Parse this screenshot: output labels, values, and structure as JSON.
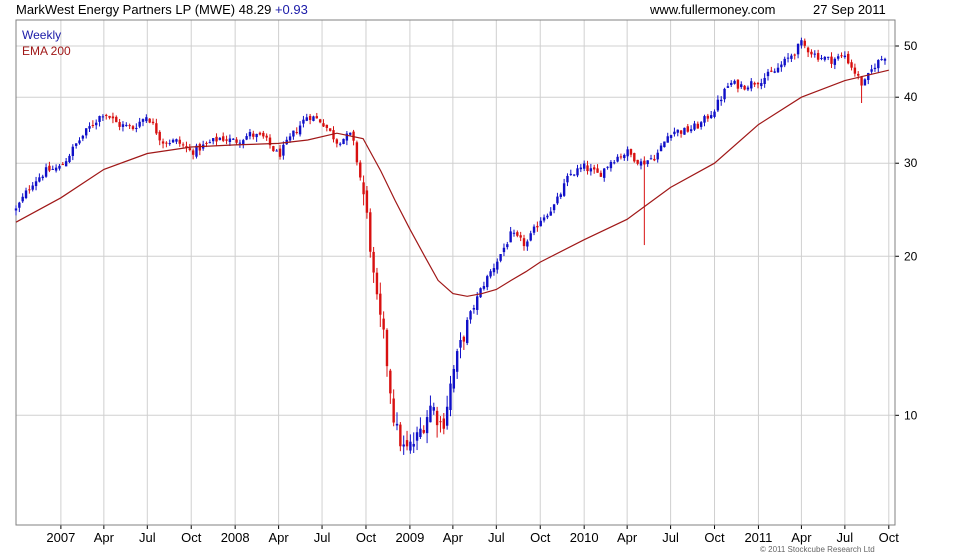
{
  "header": {
    "title": "MarkWest Energy Partners LP (MWE)",
    "price": "48.29",
    "change": "+0.93",
    "site": "www.fullermoney.com",
    "date": "27 Sep 2011"
  },
  "legend": {
    "frequency": "Weekly",
    "indicator": "EMA 200"
  },
  "credit": "© 2011 Stockcube Research Ltd",
  "colors": {
    "up": "#1010c8",
    "down": "#d81010",
    "ema": "#a01818",
    "grid": "#d0d0d0",
    "frame": "#808080"
  },
  "chart_data": {
    "type": "candlestick",
    "title": "MarkWest Energy Partners LP (MWE) 48.29 +0.93",
    "frequency": "Weekly",
    "y_scale": "log",
    "ylim": [
      6.2,
      56
    ],
    "y_ticks": [
      10,
      20,
      30,
      40,
      50
    ],
    "x_labels": [
      "2007",
      "Apr",
      "Jul",
      "Oct",
      "2008",
      "Apr",
      "Jul",
      "Oct",
      "2009",
      "Apr",
      "Jul",
      "Oct",
      "2010",
      "Apr",
      "Jul",
      "Oct",
      "2011",
      "Apr",
      "Jul",
      "Oct"
    ],
    "x_start": "2006-09-29",
    "x_end": "2011-10-14",
    "grid": true,
    "close_path": [
      [
        "2006-09-29",
        24.5
      ],
      [
        "2006-11-01",
        27.5
      ],
      [
        "2006-12-01",
        29.0
      ],
      [
        "2007-01-01",
        29.5
      ],
      [
        "2007-02-01",
        32.5
      ],
      [
        "2007-03-01",
        35.0
      ],
      [
        "2007-04-01",
        37.5
      ],
      [
        "2007-05-01",
        35.5
      ],
      [
        "2007-06-01",
        35.0
      ],
      [
        "2007-07-01",
        37.0
      ],
      [
        "2007-08-01",
        33.0
      ],
      [
        "2007-09-01",
        33.0
      ],
      [
        "2007-10-01",
        31.5
      ],
      [
        "2007-11-01",
        32.5
      ],
      [
        "2007-12-01",
        33.5
      ],
      [
        "2008-01-01",
        33.0
      ],
      [
        "2008-02-01",
        34.0
      ],
      [
        "2008-03-01",
        33.5
      ],
      [
        "2008-04-01",
        31.0
      ],
      [
        "2008-05-01",
        34.0
      ],
      [
        "2008-06-01",
        37.0
      ],
      [
        "2008-07-01",
        36.0
      ],
      [
        "2008-08-01",
        33.0
      ],
      [
        "2008-09-01",
        34.0
      ],
      [
        "2008-09-25",
        26.5
      ],
      [
        "2008-10-08",
        22.0
      ],
      [
        "2008-10-20",
        17.0
      ],
      [
        "2008-11-10",
        13.5
      ],
      [
        "2008-12-01",
        9.5
      ],
      [
        "2008-12-22",
        8.5
      ],
      [
        "2009-01-15",
        9.0
      ],
      [
        "2009-02-15",
        10.5
      ],
      [
        "2009-03-10",
        9.5
      ],
      [
        "2009-04-01",
        12.0
      ],
      [
        "2009-05-01",
        15.0
      ],
      [
        "2009-06-01",
        17.5
      ],
      [
        "2009-07-01",
        19.5
      ],
      [
        "2009-08-01",
        22.0
      ],
      [
        "2009-09-01",
        21.0
      ],
      [
        "2009-10-01",
        23.5
      ],
      [
        "2009-11-01",
        25.0
      ],
      [
        "2009-12-01",
        28.5
      ],
      [
        "2010-01-01",
        29.5
      ],
      [
        "2010-02-01",
        28.5
      ],
      [
        "2010-03-01",
        30.5
      ],
      [
        "2010-04-01",
        31.5
      ],
      [
        "2010-05-01",
        30.0
      ],
      [
        "2010-06-01",
        31.0
      ],
      [
        "2010-07-01",
        34.5
      ],
      [
        "2010-08-01",
        34.5
      ],
      [
        "2010-09-01",
        35.5
      ],
      [
        "2010-10-01",
        38.0
      ],
      [
        "2010-11-01",
        42.5
      ],
      [
        "2010-12-01",
        42.0
      ],
      [
        "2011-01-01",
        43.0
      ],
      [
        "2011-02-01",
        44.5
      ],
      [
        "2011-03-01",
        47.0
      ],
      [
        "2011-04-01",
        50.5
      ],
      [
        "2011-05-01",
        48.0
      ],
      [
        "2011-06-01",
        47.0
      ],
      [
        "2011-07-01",
        48.0
      ],
      [
        "2011-08-08",
        42.0
      ],
      [
        "2011-09-01",
        46.0
      ],
      [
        "2011-09-27",
        48.29
      ]
    ],
    "spikes": [
      [
        "2010-05-06",
        21.0
      ],
      [
        "2011-08-08",
        39.0
      ]
    ],
    "ema_path": [
      [
        "2006-09-29",
        23.2
      ],
      [
        "2007-01-01",
        25.8
      ],
      [
        "2007-04-01",
        29.2
      ],
      [
        "2007-07-01",
        31.3
      ],
      [
        "2007-10-01",
        32.2
      ],
      [
        "2008-01-01",
        32.5
      ],
      [
        "2008-04-01",
        32.7
      ],
      [
        "2008-06-01",
        33.2
      ],
      [
        "2008-08-01",
        34.2
      ],
      [
        "2008-09-25",
        33.4
      ],
      [
        "2008-11-01",
        29.0
      ],
      [
        "2008-12-01",
        25.5
      ],
      [
        "2009-01-01",
        22.5
      ],
      [
        "2009-02-01",
        20.0
      ],
      [
        "2009-03-01",
        18.0
      ],
      [
        "2009-04-01",
        17.0
      ],
      [
        "2009-05-01",
        16.8
      ],
      [
        "2009-06-01",
        17.0
      ],
      [
        "2009-07-01",
        17.3
      ],
      [
        "2009-08-01",
        18.0
      ],
      [
        "2009-09-01",
        18.7
      ],
      [
        "2009-10-01",
        19.5
      ],
      [
        "2010-01-01",
        21.5
      ],
      [
        "2010-04-01",
        23.5
      ],
      [
        "2010-07-01",
        27.0
      ],
      [
        "2010-10-01",
        30.0
      ],
      [
        "2011-01-01",
        35.5
      ],
      [
        "2011-04-01",
        40.0
      ],
      [
        "2011-07-01",
        43.0
      ],
      [
        "2011-10-01",
        45.0
      ]
    ]
  }
}
